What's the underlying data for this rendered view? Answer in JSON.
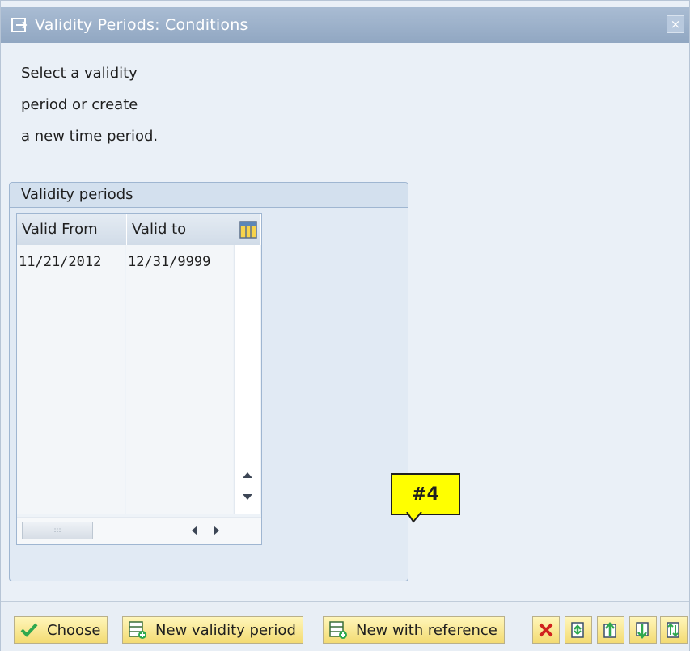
{
  "window": {
    "title": "Validity Periods: Conditions",
    "close_symbol": "×"
  },
  "intro": {
    "line1": "Select a validity",
    "line2": "period or create",
    "line3": "a new time period."
  },
  "groupbox": {
    "title": "Validity periods"
  },
  "table": {
    "columns": [
      "Valid From",
      "Valid to"
    ],
    "rows": [
      [
        "11/21/2012",
        "12/31/9999"
      ]
    ],
    "scrollbar_grip": ":::"
  },
  "callout": {
    "label": "#4"
  },
  "toolbar": {
    "buttons": [
      {
        "label": "Choose",
        "icon": "check-icon"
      },
      {
        "label": "New validity period",
        "icon": "new-row-icon"
      },
      {
        "label": "New with reference",
        "icon": "new-row-icon"
      }
    ],
    "icon_buttons": [
      "cancel-icon",
      "reload-icon",
      "upload-icon",
      "download-icon",
      "sync-icon"
    ]
  },
  "colors": {
    "accent_yellow": "#ffff00",
    "titlebar": "#9fb3cb",
    "button_yellow": "#f3db73",
    "check_green": "#2fa84f",
    "cancel_red": "#d0221f"
  }
}
